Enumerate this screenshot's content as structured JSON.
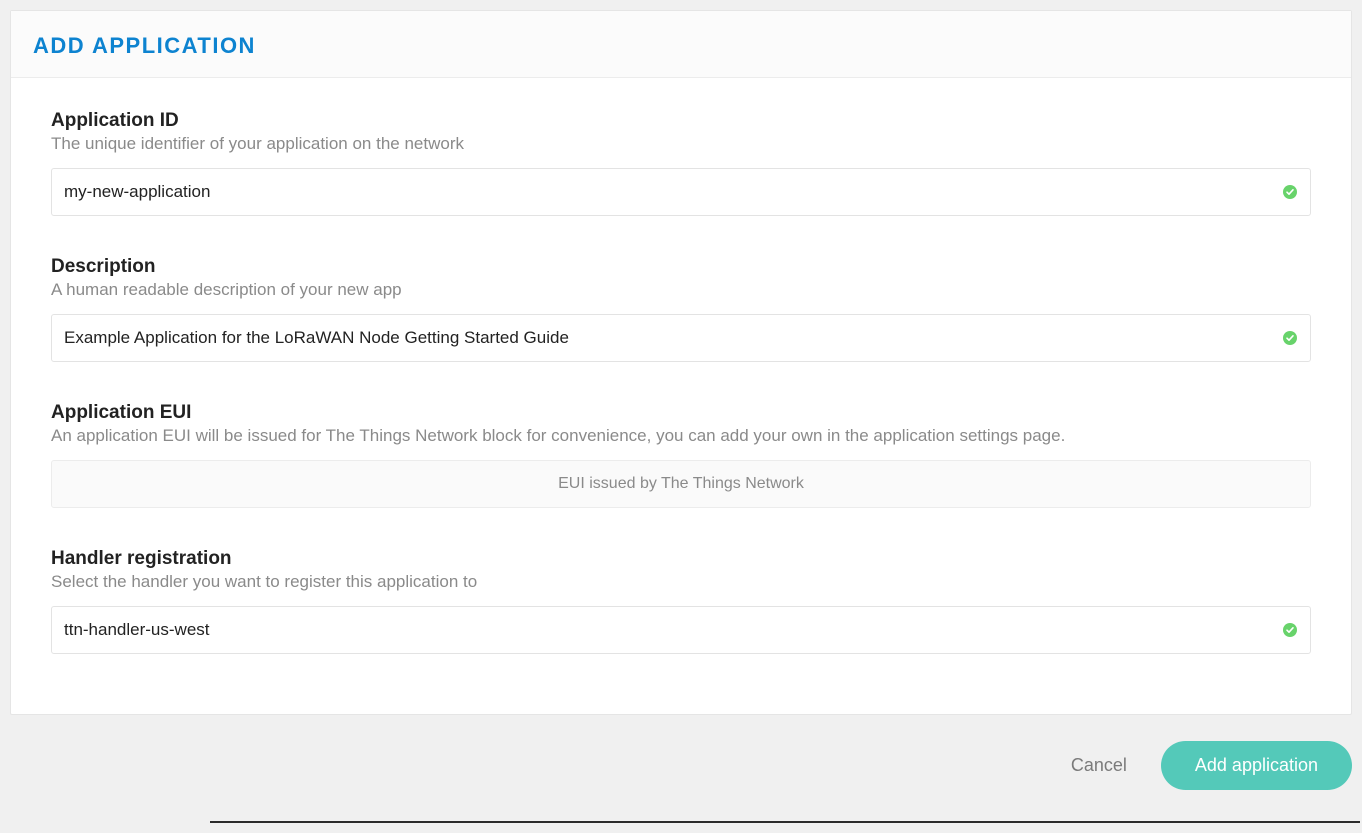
{
  "header": {
    "title": "ADD APPLICATION"
  },
  "fields": {
    "appId": {
      "label": "Application ID",
      "help": "The unique identifier of your application on the network",
      "value": "my-new-application",
      "valid": true
    },
    "description": {
      "label": "Description",
      "help": "A human readable description of your new app",
      "value": "Example Application for the LoRaWAN Node Getting Started Guide",
      "valid": true
    },
    "appEui": {
      "label": "Application EUI",
      "help": "An application EUI will be issued for The Things Network block for convenience, you can add your own in the application settings page.",
      "readonly_text": "EUI issued by The Things Network"
    },
    "handler": {
      "label": "Handler registration",
      "help": "Select the handler you want to register this application to",
      "value": "ttn-handler-us-west",
      "valid": true
    }
  },
  "footer": {
    "cancel": "Cancel",
    "submit": "Add application"
  },
  "colors": {
    "accent": "#0d83d0",
    "primaryButton": "#54c9b9",
    "validIcon": "#68d36b"
  }
}
